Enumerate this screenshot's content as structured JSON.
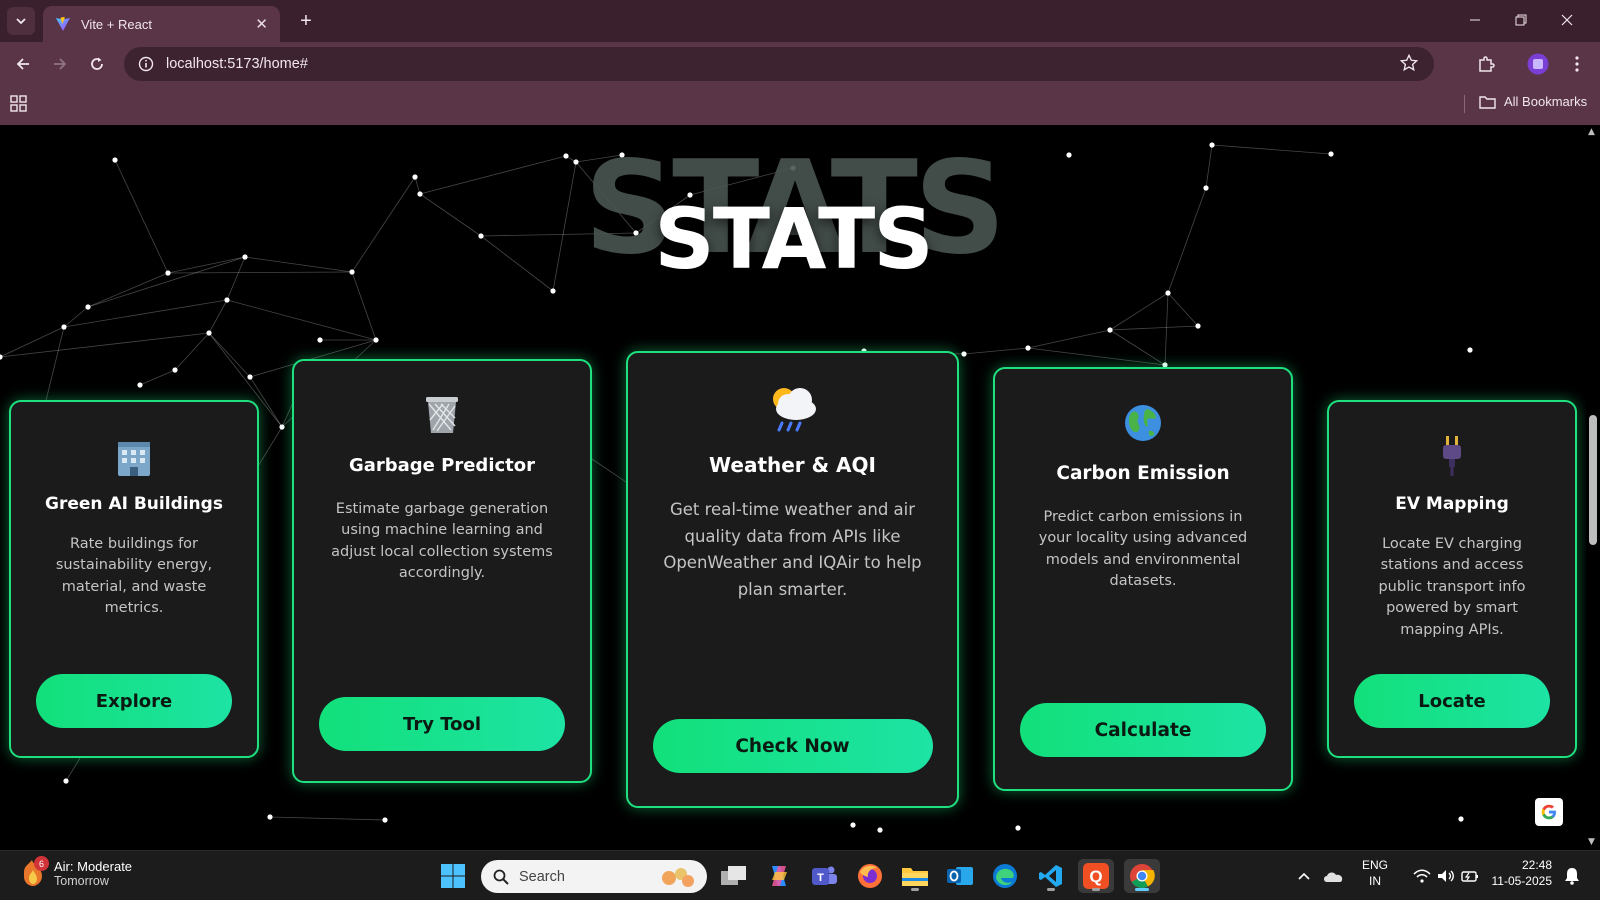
{
  "browser": {
    "tab_title": "Vite + React",
    "url": "localhost:5173/home#",
    "bookmarks_label": "All Bookmarks"
  },
  "page": {
    "heading_bg": "STATS",
    "heading": "STATS",
    "cards": [
      {
        "icon": "office-building-icon",
        "title": "Green AI Buildings",
        "description": "Rate buildings for sustainability energy, material, and waste metrics.",
        "button": "Explore"
      },
      {
        "icon": "wastebasket-icon",
        "title": "Garbage Predictor",
        "description": "Estimate garbage generation using machine learning and adjust local collection systems accordingly.",
        "button": "Try Tool"
      },
      {
        "icon": "cloud-rain-sun-icon",
        "title": "Weather & AQI",
        "description": "Get real-time weather and air quality data from APIs like OpenWeather and IQAir to help plan smarter.",
        "button": "Check Now"
      },
      {
        "icon": "globe-icon",
        "title": "Carbon Emission",
        "description": "Predict carbon emissions in your locality using advanced models and environmental datasets.",
        "button": "Calculate"
      },
      {
        "icon": "electric-plug-icon",
        "title": "EV Mapping",
        "description": "Locate EV charging stations and access public transport info powered by smart mapping APIs.",
        "button": "Locate"
      }
    ]
  },
  "taskbar": {
    "weather_badge": "6",
    "weather_title": "Air: Moderate",
    "weather_subtitle": "Tomorrow",
    "search_placeholder": "Search",
    "lang_line1": "ENG",
    "lang_line2": "IN",
    "time": "22:48",
    "date": "11-05-2025"
  },
  "colors": {
    "accent": "#1ee07f",
    "card_bg": "#1b1b1b",
    "chrome_tabbar": "#3a1f2c",
    "chrome_toolbar": "#5a3447"
  }
}
